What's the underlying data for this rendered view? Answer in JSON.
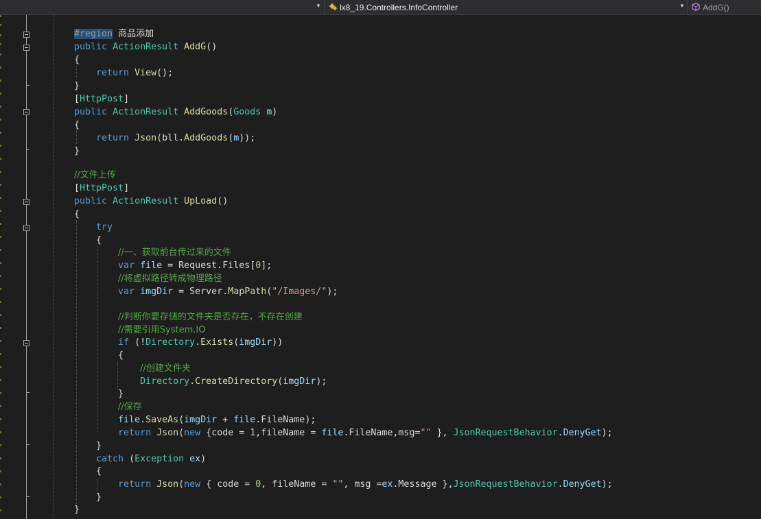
{
  "navbar": {
    "project_value": "",
    "class_value": "lx8_19.Controllers.InfoController",
    "member_value": "AddG()",
    "class_icon": "class-icon",
    "member_icon": "method-icon"
  },
  "code": {
    "l1_region": "#region",
    "l1_name": "商品添加",
    "l2_public": "public",
    "l2_type": "ActionResult",
    "l2_method": "AddG",
    "l2_parens": "()",
    "l3": "{",
    "l4_return": "return",
    "l4_view": "View",
    "l4_tail": "();",
    "l5": "}",
    "l6_open": "[",
    "l6_attr": "HttpPost",
    "l6_close": "]",
    "l7_public": "public",
    "l7_type": "ActionResult",
    "l7_method": "AddGoods",
    "l7_open": "(",
    "l7_ptype": "Goods",
    "l7_param": "m",
    "l7_close": ")",
    "l8": "{",
    "l9_return": "return",
    "l9_json": "Json",
    "l9_p1": "(bll.",
    "l9_add": "AddGoods",
    "l9_p2": "(",
    "l9_m": "m",
    "l9_p3": "));",
    "l10": "}",
    "l12_comment": "//文件上传",
    "l13_open": "[",
    "l13_attr": "HttpPost",
    "l13_close": "]",
    "l14_public": "public",
    "l14_type": "ActionResult",
    "l14_method": "UpLoad",
    "l14_parens": "()",
    "l15": "{",
    "l16_try": "try",
    "l17": "{",
    "l18_comment": "//一、获取前台传过来的文件",
    "l19_var": "var",
    "l19_name": "file",
    "l19_eq": " = Request.",
    "l19_files": "Files",
    "l19_idx1": "[",
    "l19_zero": "0",
    "l19_idx2": "];",
    "l20_comment": "//将虚拟路径转成物理路径",
    "l21_var": "var",
    "l21_name": "imgDir",
    "l21_eq": " = Server.",
    "l21_map": "MapPath",
    "l21_p1": "(",
    "l21_str": "\"/Images/\"",
    "l21_p2": ");",
    "l23_comment": "//判断你要存储的文件夹是否存在，不存在创建",
    "l24_comment": "//需要引用System.IO",
    "l25_if": "if",
    "l25_p1": " (!",
    "l25_dir": "Directory",
    "l25_dot": ".",
    "l25_exists": "Exists",
    "l25_p2": "(",
    "l25_arg": "imgDir",
    "l25_p3": "))",
    "l26": "{",
    "l27_comment": "//创建文件夹",
    "l28_dir": "Directory",
    "l28_dot": ".",
    "l28_create": "CreateDirectory",
    "l28_p1": "(",
    "l28_arg": "imgDir",
    "l28_p2": ");",
    "l29": "}",
    "l30_comment": "//保存",
    "l31_file": "file",
    "l31_dot": ".",
    "l31_save": "SaveAs",
    "l31_p1": "(",
    "l31_img": "imgDir",
    "l31_plus": " + ",
    "l31_file2": "file",
    "l31_fn": ".FileName);",
    "l32_return": "return",
    "l32_json": "Json",
    "l32_p1": "(",
    "l32_new": "new",
    "l32_body1": " {code = ",
    "l32_one": "1",
    "l32_body2": ",fileName = ",
    "l32_file": "file",
    "l32_body3": ".FileName,msg=",
    "l32_str": "\"\"",
    "l32_body4": " }, ",
    "l32_jrb": "JsonRequestBehavior",
    "l32_dot": ".",
    "l32_deny": "DenyGet",
    "l32_end": ");",
    "l33": "}",
    "l34_catch": "catch",
    "l34_p1": " (",
    "l34_ex": "Exception",
    "l34_sp": " ",
    "l34_var": "ex",
    "l34_p2": ")",
    "l35": "{",
    "l36_return": "return",
    "l36_json": "Json",
    "l36_p1": "(",
    "l36_new": "new",
    "l36_body1": " { code = ",
    "l36_zero": "0",
    "l36_body2": ", fileName = ",
    "l36_str": "\"\"",
    "l36_body3": ", msg =",
    "l36_ex": "ex",
    "l36_body4": ".Message },",
    "l36_jrb": "JsonRequestBehavior",
    "l36_dot": ".",
    "l36_deny": "DenyGet",
    "l36_end": ");",
    "l37": "}",
    "l38": "}"
  }
}
